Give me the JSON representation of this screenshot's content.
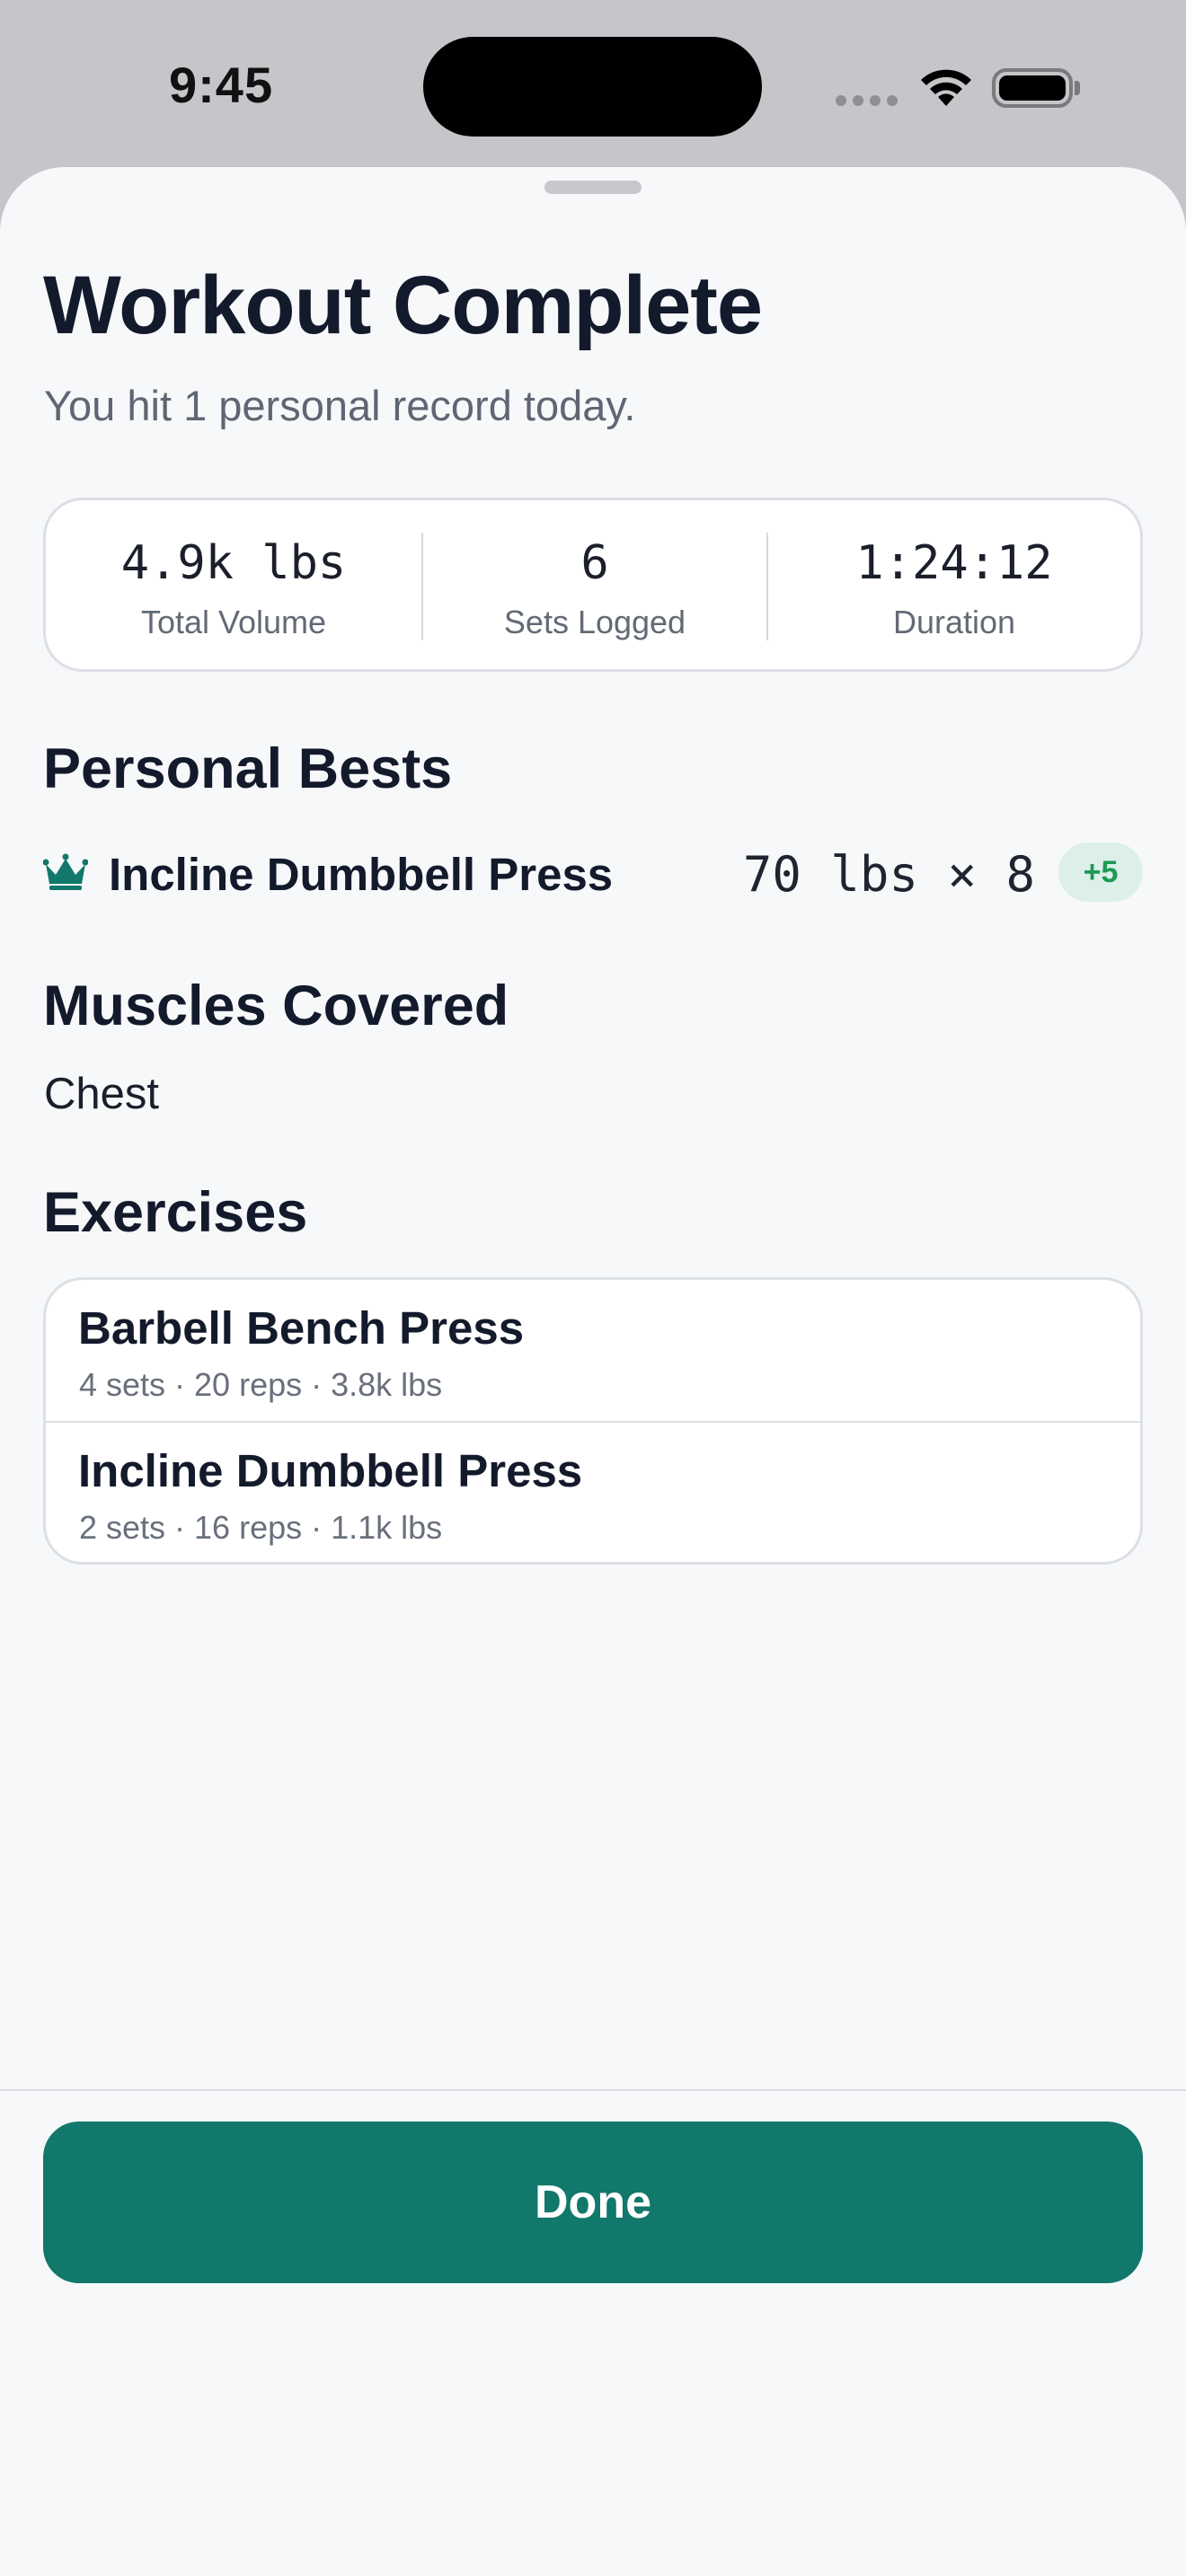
{
  "status_bar": {
    "time": "9:45"
  },
  "summary": {
    "title": "Workout Complete",
    "subtitle": "You hit 1 personal record today."
  },
  "stats": [
    {
      "value": "4.9k lbs",
      "label": "Total Volume"
    },
    {
      "value": "6",
      "label": "Sets Logged"
    },
    {
      "value": "1:24:12",
      "label": "Duration"
    }
  ],
  "personal_bests": {
    "heading": "Personal Bests",
    "items": [
      {
        "icon": "crown-icon",
        "exercise": "Incline Dumbbell Press",
        "value": "70 lbs × 8",
        "badge": "+5"
      }
    ]
  },
  "muscles": {
    "heading": "Muscles Covered",
    "value": "Chest"
  },
  "exercises": {
    "heading": "Exercises",
    "items": [
      {
        "name": "Barbell Bench Press",
        "meta": "4 sets · 20 reps · 3.8k lbs"
      },
      {
        "name": "Incline Dumbbell Press",
        "meta": "2 sets · 16 reps · 1.1k lbs"
      }
    ]
  },
  "actions": {
    "done_label": "Done"
  },
  "colors": {
    "accent": "#11786b",
    "badge_text": "#1e9a52",
    "badge_bg": "#dcefe9",
    "sheet_bg": "#f7f8fa"
  }
}
